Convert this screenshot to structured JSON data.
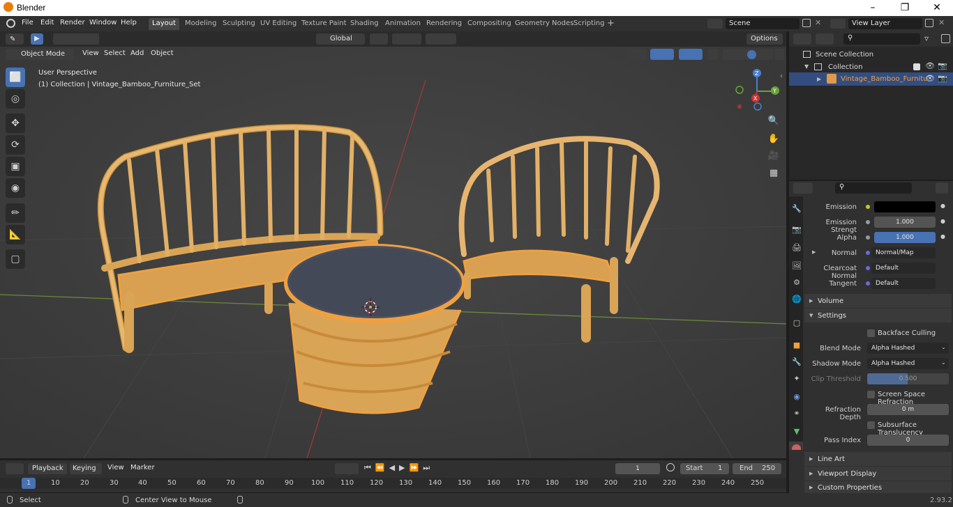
{
  "app": {
    "title": "Blender",
    "version": "2.93.2"
  },
  "menu": [
    "File",
    "Edit",
    "Render",
    "Window",
    "Help"
  ],
  "workspaces": [
    "Layout",
    "Modeling",
    "Sculpting",
    "UV Editing",
    "Texture Paint",
    "Shading",
    "Animation",
    "Rendering",
    "Compositing",
    "Geometry Nodes",
    "Scripting"
  ],
  "active_workspace": "Layout",
  "scene": {
    "scene_name": "Scene",
    "view_layer": "View Layer"
  },
  "viewport": {
    "transform_orientation": "Global",
    "options_label": "Options",
    "mode": "Object Mode",
    "header_menu": [
      "View",
      "Select",
      "Add",
      "Object"
    ],
    "perspective": "User Perspective",
    "collection_info": "(1) Collection | Vintage_Bamboo_Furniture_Set"
  },
  "outliner": {
    "scene_collection": "Scene Collection",
    "collection": "Collection",
    "object": "Vintage_Bamboo_Furnitu"
  },
  "properties": {
    "rows": [
      {
        "label": "Emission",
        "value": ""
      },
      {
        "label": "Emission Strengt",
        "value": "1.000"
      },
      {
        "label": "Alpha",
        "value": "1.000"
      },
      {
        "label": "Normal",
        "value": "Normal/Map"
      },
      {
        "label": "Clearcoat Normal",
        "value": "Default"
      },
      {
        "label": "Tangent",
        "value": "Default"
      }
    ],
    "volume": "Volume",
    "settings": "Settings",
    "backface_culling": "Backface Culling",
    "blend_mode_label": "Blend Mode",
    "blend_mode": "Alpha Hashed",
    "shadow_mode_label": "Shadow Mode",
    "shadow_mode": "Alpha Hashed",
    "clip_threshold_label": "Clip Threshold",
    "clip_threshold": "0.500",
    "ssr": "Screen Space Refraction",
    "refraction_depth_label": "Refraction Depth",
    "refraction_depth": "0 m",
    "sss": "Subsurface Translucency",
    "pass_index_label": "Pass Index",
    "pass_index": "0",
    "line_art": "Line Art",
    "viewport_display": "Viewport Display",
    "custom_properties": "Custom Properties"
  },
  "timeline": {
    "menu": [
      "Playback",
      "Keying",
      "View",
      "Marker"
    ],
    "current_frame": "1",
    "start_label": "Start",
    "start": "1",
    "end_label": "End",
    "end": "250",
    "ruler": [
      "1",
      "10",
      "20",
      "30",
      "40",
      "50",
      "60",
      "70",
      "80",
      "90",
      "100",
      "110",
      "120",
      "130",
      "140",
      "150",
      "160",
      "170",
      "180",
      "190",
      "200",
      "210",
      "220",
      "230",
      "240",
      "250"
    ]
  },
  "status": {
    "select": "Select",
    "center": "Center View to Mouse"
  }
}
